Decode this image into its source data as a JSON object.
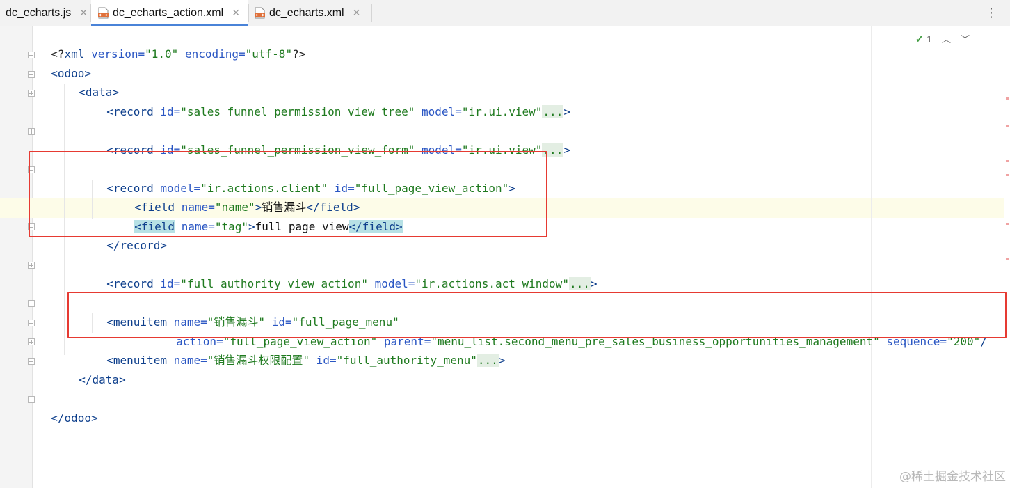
{
  "tabs": [
    {
      "label": "dc_echarts.js",
      "icon": "js-file-icon",
      "active": false
    },
    {
      "label": "dc_echarts_action.xml",
      "icon": "xml-file-icon",
      "active": true
    },
    {
      "label": "dc_echarts.xml",
      "icon": "xml-file-icon",
      "active": false
    }
  ],
  "toolbar": {
    "more_icon": "⋮"
  },
  "inspection": {
    "count": "1",
    "icon": "check-icon"
  },
  "code": {
    "line1": {
      "open": "<?",
      "tag": "xml",
      "attr1": " version=",
      "val1": "\"1.0\"",
      "attr2": " encoding=",
      "val2": "\"utf-8\"",
      "close": "?>"
    },
    "line2": {
      "text": "<odoo>"
    },
    "line3": {
      "text": "<data>"
    },
    "line4": {
      "open": "<record",
      "attr1": " id=",
      "val1": "\"sales_funnel_permission_view_tree\"",
      "attr2": " model=",
      "val2": "\"ir.ui.view\"",
      "dots": "...",
      "close": ">"
    },
    "line5": {
      "open": "<record",
      "attr1": " id=",
      "val1": "\"sales_funnel_permission_view_form\"",
      "attr2": " model=",
      "val2": "\"ir.ui.view\"",
      "dots": "...",
      "close": ">"
    },
    "line6": {
      "open": "<record",
      "attr1": " model=",
      "val1": "\"ir.actions.client\"",
      "attr2": " id=",
      "val2": "\"full_page_view_action\"",
      "close": ">"
    },
    "line7": {
      "open": "<field",
      "attr1": " name=",
      "val1": "\"name\"",
      "gt": ">",
      "content": "销售漏斗",
      "close": "</field>"
    },
    "line8": {
      "open": "<field",
      "attr1": " name=",
      "val1": "\"tag\"",
      "gt": ">",
      "content": "full_page_view",
      "close": "</field>"
    },
    "line9": {
      "text": "</record>"
    },
    "line10": {
      "open": "<record",
      "attr1": " id=",
      "val1": "\"full_authority_view_action\"",
      "attr2": " model=",
      "val2": "\"ir.actions.act_window\"",
      "dots": "...",
      "close": ">"
    },
    "line11": {
      "open": "<menuitem",
      "attr1": " name=",
      "val1": "\"销售漏斗\"",
      "attr2": " id=",
      "val2": "\"full_page_menu\""
    },
    "line12": {
      "attr1": "action=",
      "val1": "\"full_page_view_action\"",
      "attr2": " parent=",
      "val2": "\"menu_list.second_menu_pre_sales_business_opportunities_management\"",
      "attr3": " sequence=",
      "val3": "\"200\"",
      "close": "/"
    },
    "line13": {
      "open": "<menuitem",
      "attr1": " name=",
      "val1": "\"销售漏斗权限配置\"",
      "attr2": " id=",
      "val2": "\"full_authority_menu\"",
      "dots": "...",
      "close": ">"
    },
    "line14": {
      "text": "</data>"
    },
    "line15": {
      "text": "</odoo>"
    }
  },
  "watermark": "@稀土掘金技术社区",
  "colors": {
    "tag": "#0e3f8c",
    "attr": "#2a56c3",
    "value": "#1f7a1f",
    "highlight": "#e63a32",
    "active_tab": "#4a83d8"
  }
}
